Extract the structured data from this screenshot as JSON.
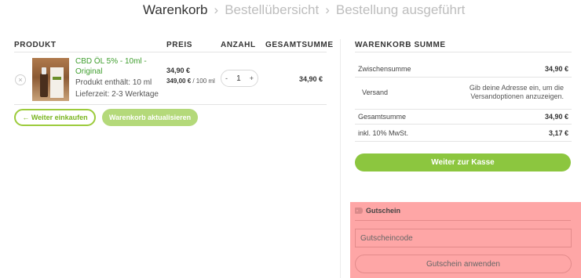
{
  "breadcrumb": {
    "steps": [
      "Warenkorb",
      "Bestellübersicht",
      "Bestellung ausgeführt"
    ],
    "separator": "›"
  },
  "table": {
    "headers": [
      "PRODUKT",
      "PREIS",
      "ANZAHL",
      "GESAMTSUMME"
    ],
    "item": {
      "remove_label": "×",
      "name": "CBD ÖL 5% - 10ml - Original",
      "content": "Produkt enthält: 10 ml",
      "delivery": "Lieferzeit: 2-3 Werktage",
      "price": "34,90 €",
      "unit_price": "349,00 €",
      "unit_suffix": " / 100 ml",
      "qty_minus": "-",
      "qty": "1",
      "qty_plus": "+",
      "subtotal": "34,90 €"
    }
  },
  "actions": {
    "continue_label": "← Weiter einkaufen",
    "update_label": "Warenkorb aktualisieren"
  },
  "summary": {
    "title": "WARENKORB SUMME",
    "subtotal_label": "Zwischensumme",
    "subtotal_value": "34,90 €",
    "shipping_label": "Versand",
    "shipping_note": "Gib deine Adresse ein, um die Versandoptionen anzuzeigen.",
    "total_label": "Gesamtsumme",
    "total_value": "34,90 €",
    "tax_label": "inkl. 10% MwSt.",
    "tax_value": "3,17 €",
    "checkout_label": "Weiter zur Kasse"
  },
  "coupon": {
    "title": "Gutschein",
    "placeholder": "Gutscheincode",
    "apply_label": "Gutschein anwenden",
    "icon": "tag-icon"
  },
  "colors": {
    "accent": "#8cc63f",
    "link": "#3f9e2e",
    "highlight": "#fea6a6"
  }
}
